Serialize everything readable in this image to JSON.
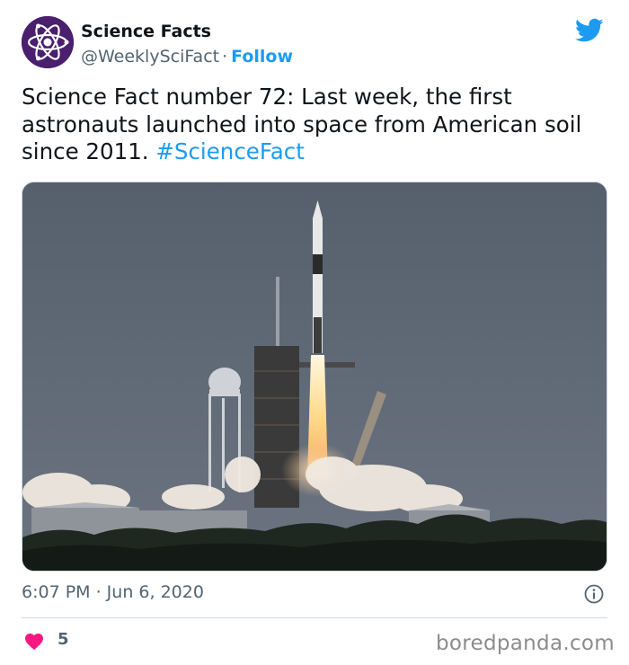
{
  "tweet": {
    "author_name": "Science Facts",
    "handle": "@WeeklySciFact",
    "separator": "·",
    "follow_label": "Follow",
    "text_main": "Science Fact number 72: Last week, the first astronauts launched into space from American soil since 2011.",
    "hashtag": "#ScienceFact",
    "timestamp": "6:07 PM · Jun 6, 2020",
    "like_count": "5"
  },
  "watermark": "boredpanda.com",
  "colors": {
    "accent": "#1d9bf0",
    "like": "#f91880",
    "avatar_bg": "#4a1f6e",
    "text": "#0f1419",
    "secondary_text": "#536471"
  },
  "icons": {
    "avatar": "atom-logo-icon",
    "brand": "twitter-bird-icon",
    "info": "info-circle-icon",
    "like": "heart-icon"
  }
}
